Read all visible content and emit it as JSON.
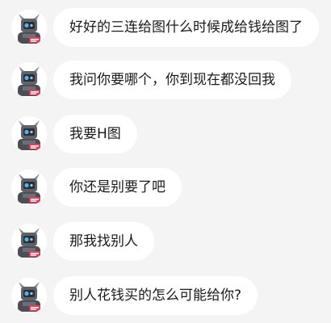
{
  "messages": [
    {
      "text": "好好的三连给图什么时候成给钱给图了"
    },
    {
      "text": "我问你要哪个，你到现在都没回我"
    },
    {
      "text": "我要H图"
    },
    {
      "text": "你还是别要了吧"
    },
    {
      "text": "那我找别人"
    },
    {
      "text": "别人花钱买的怎么可能给你?"
    }
  ],
  "avatar": {
    "icon": "robot-avatar-icon"
  },
  "colors": {
    "background": "#f4f4f5",
    "bubble": "#ffffff",
    "text": "#1a1a1a"
  }
}
